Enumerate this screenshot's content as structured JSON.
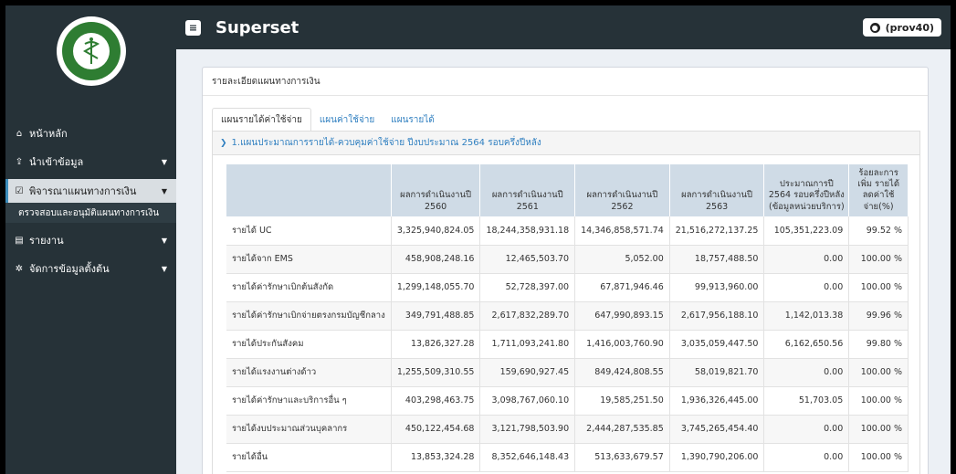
{
  "header": {
    "brand": "Superset",
    "user": "(prov40)"
  },
  "sidebar": {
    "items": [
      {
        "icon": "home-icon",
        "glyph": "⌂",
        "label": "หน้าหลัก",
        "caret": false
      },
      {
        "icon": "upload-icon",
        "glyph": "⇪",
        "label": "นำเข้าข้อมูล",
        "caret": true
      },
      {
        "icon": "check-square-icon",
        "glyph": "☑",
        "label": "พิจารณาแผนทางการเงิน",
        "caret": true,
        "active": true
      },
      {
        "icon": "file-icon",
        "glyph": "▤",
        "label": "รายงาน",
        "caret": true
      },
      {
        "icon": "gear-icon",
        "glyph": "✲",
        "label": "จัดการข้อมูลตั้งต้น",
        "caret": true
      }
    ],
    "sub_item": "ตรวจสอบและอนุมัติแผนทางการเงิน"
  },
  "panel": {
    "title": "รายละเอียดแผนทางการเงิน",
    "tabs": [
      "แผนรายได้ค่าใช้จ่าย",
      "แผนค่าใช้จ่าย",
      "แผนรายได้"
    ],
    "accordion": "1.แผนประมาณการรายได้-ควบคุมค่าใช้จ่าย ปีงบประมาณ 2564 รอบครึ่งปีหลัง"
  },
  "table": {
    "headers": [
      "",
      "ผลการดำเนินงานปี 2560",
      "ผลการดำเนินงานปี 2561",
      "ผลการดำเนินงานปี 2562",
      "ผลการดำเนินงานปี 2563",
      "ประมาณการปี 2564 รอบครึ่งปีหลัง (ข้อมูลหน่วยบริการ)",
      "ร้อยละการเพิ่ม รายได้ ลดค่าใช้จ่าย(%)"
    ],
    "rows": [
      [
        "รายได้ UC",
        "3,325,940,824.05",
        "18,244,358,931.18",
        "14,346,858,571.74",
        "21,516,272,137.25",
        "105,351,223.09",
        "99.52 %"
      ],
      [
        "รายได้จาก EMS",
        "458,908,248.16",
        "12,465,503.70",
        "5,052.00",
        "18,757,488.50",
        "0.00",
        "100.00 %"
      ],
      [
        "รายได้ค่ารักษาเบิกต้นสังกัด",
        "1,299,148,055.70",
        "52,728,397.00",
        "67,871,946.46",
        "99,913,960.00",
        "0.00",
        "100.00 %"
      ],
      [
        "รายได้ค่ารักษาเบิกจ่ายตรงกรมบัญชีกลาง",
        "349,791,488.85",
        "2,617,832,289.70",
        "647,990,893.15",
        "2,617,956,188.10",
        "1,142,013.38",
        "99.96 %"
      ],
      [
        "รายได้ประกันสังคม",
        "13,826,327.28",
        "1,711,093,241.80",
        "1,416,003,760.90",
        "3,035,059,447.50",
        "6,162,650.56",
        "99.80 %"
      ],
      [
        "รายได้แรงงานต่างด้าว",
        "1,255,509,310.55",
        "159,690,927.45",
        "849,424,808.55",
        "58,019,821.70",
        "0.00",
        "100.00 %"
      ],
      [
        "รายได้ค่ารักษาและบริการอื่น ๆ",
        "403,298,463.75",
        "3,098,767,060.10",
        "19,585,251.50",
        "1,936,326,445.00",
        "51,703.05",
        "100.00 %"
      ],
      [
        "รายได้งบประมาณส่วนบุคลากร",
        "450,122,454.68",
        "3,121,798,503.90",
        "2,444,287,535.85",
        "3,745,265,454.40",
        "0.00",
        "100.00 %"
      ],
      [
        "รายได้อื่น",
        "13,853,324.28",
        "8,352,646,148.43",
        "513,633,679.57",
        "1,390,790,206.00",
        "0.00",
        "100.00 %"
      ]
    ]
  }
}
